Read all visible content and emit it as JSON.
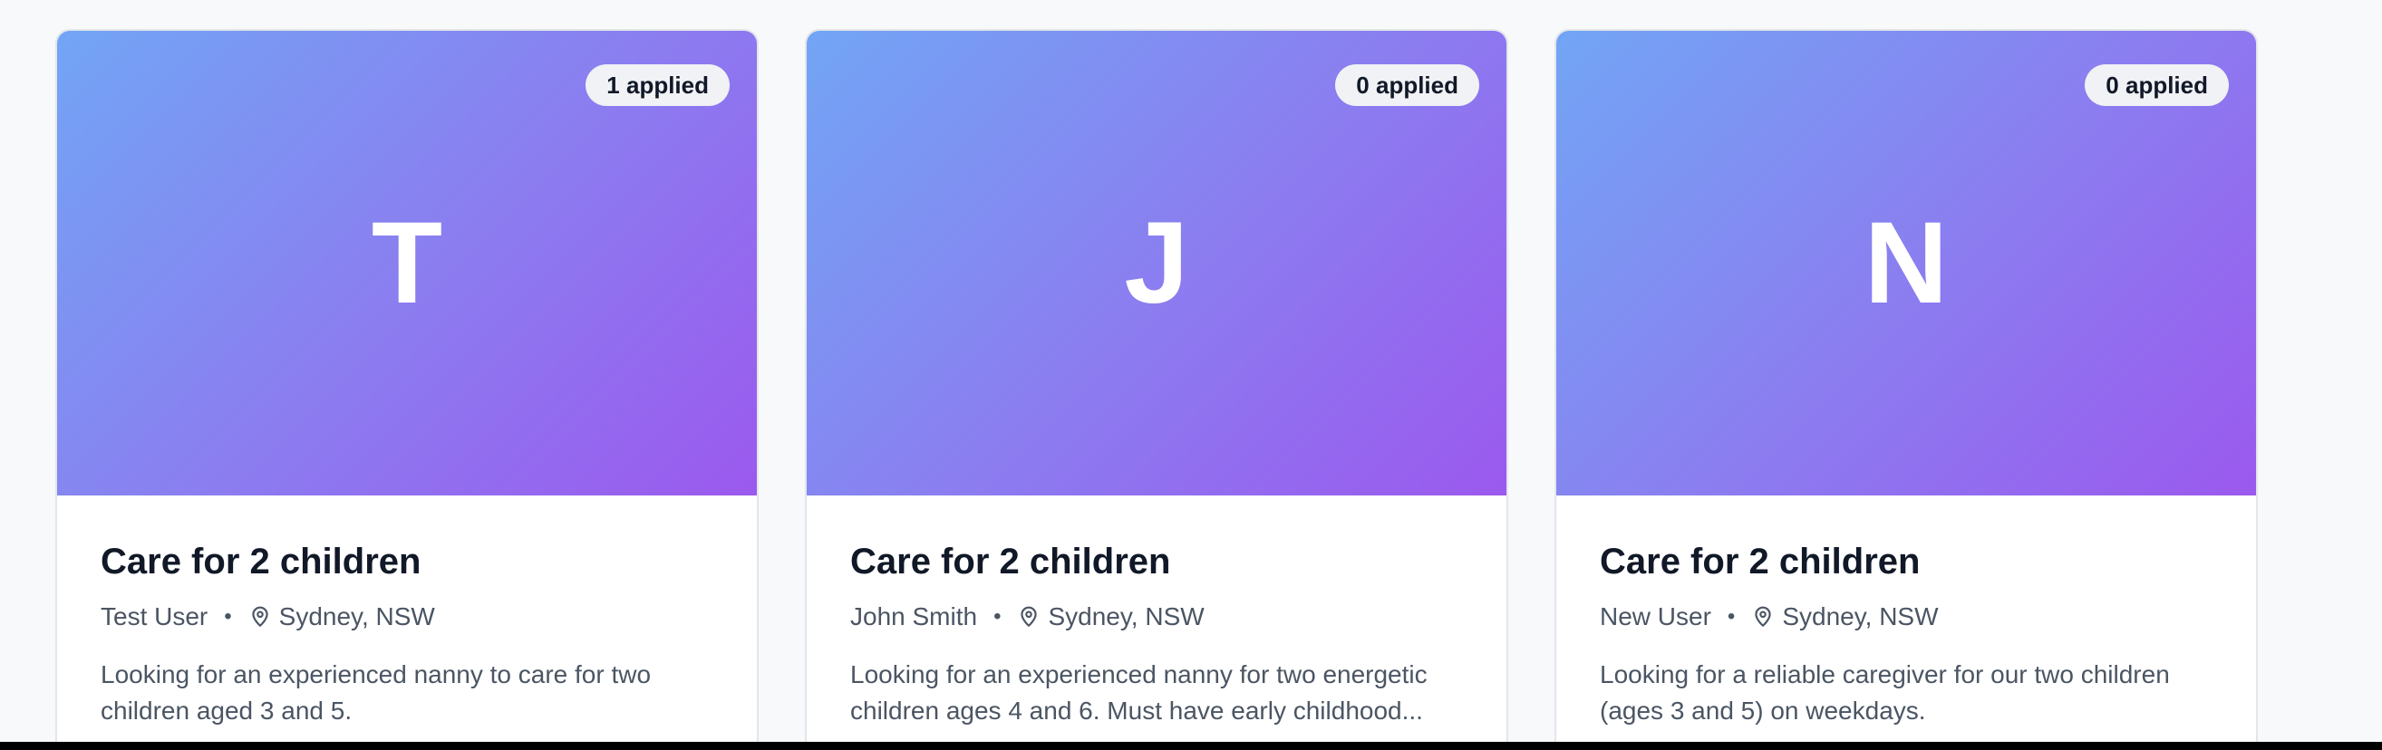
{
  "cards": [
    {
      "applied": "1 applied",
      "initial": "T",
      "title": "Care for 2 children",
      "poster": "Test User",
      "separator": "•",
      "location": "Sydney, NSW",
      "description": "Looking for an experienced nanny to care for two children aged 3 and 5."
    },
    {
      "applied": "0 applied",
      "initial": "J",
      "title": "Care for 2 children",
      "poster": "John Smith",
      "separator": "•",
      "location": "Sydney, NSW",
      "description": "Looking for an experienced nanny for two energetic children ages 4 and 6. Must have early childhood..."
    },
    {
      "applied": "0 applied",
      "initial": "N",
      "title": "Care for 2 children",
      "poster": "New User",
      "separator": "•",
      "location": "Sydney, NSW",
      "description": "Looking for a reliable caregiver for our two children (ages 3 and 5) on weekdays."
    }
  ],
  "icons": {
    "location": "map-pin-icon"
  },
  "colors": {
    "gradient_start": "#72a5f5",
    "gradient_end": "#9b59ee",
    "title_text": "#111827",
    "meta_text": "#4b5563",
    "badge_bg": "#f0f2f5"
  }
}
